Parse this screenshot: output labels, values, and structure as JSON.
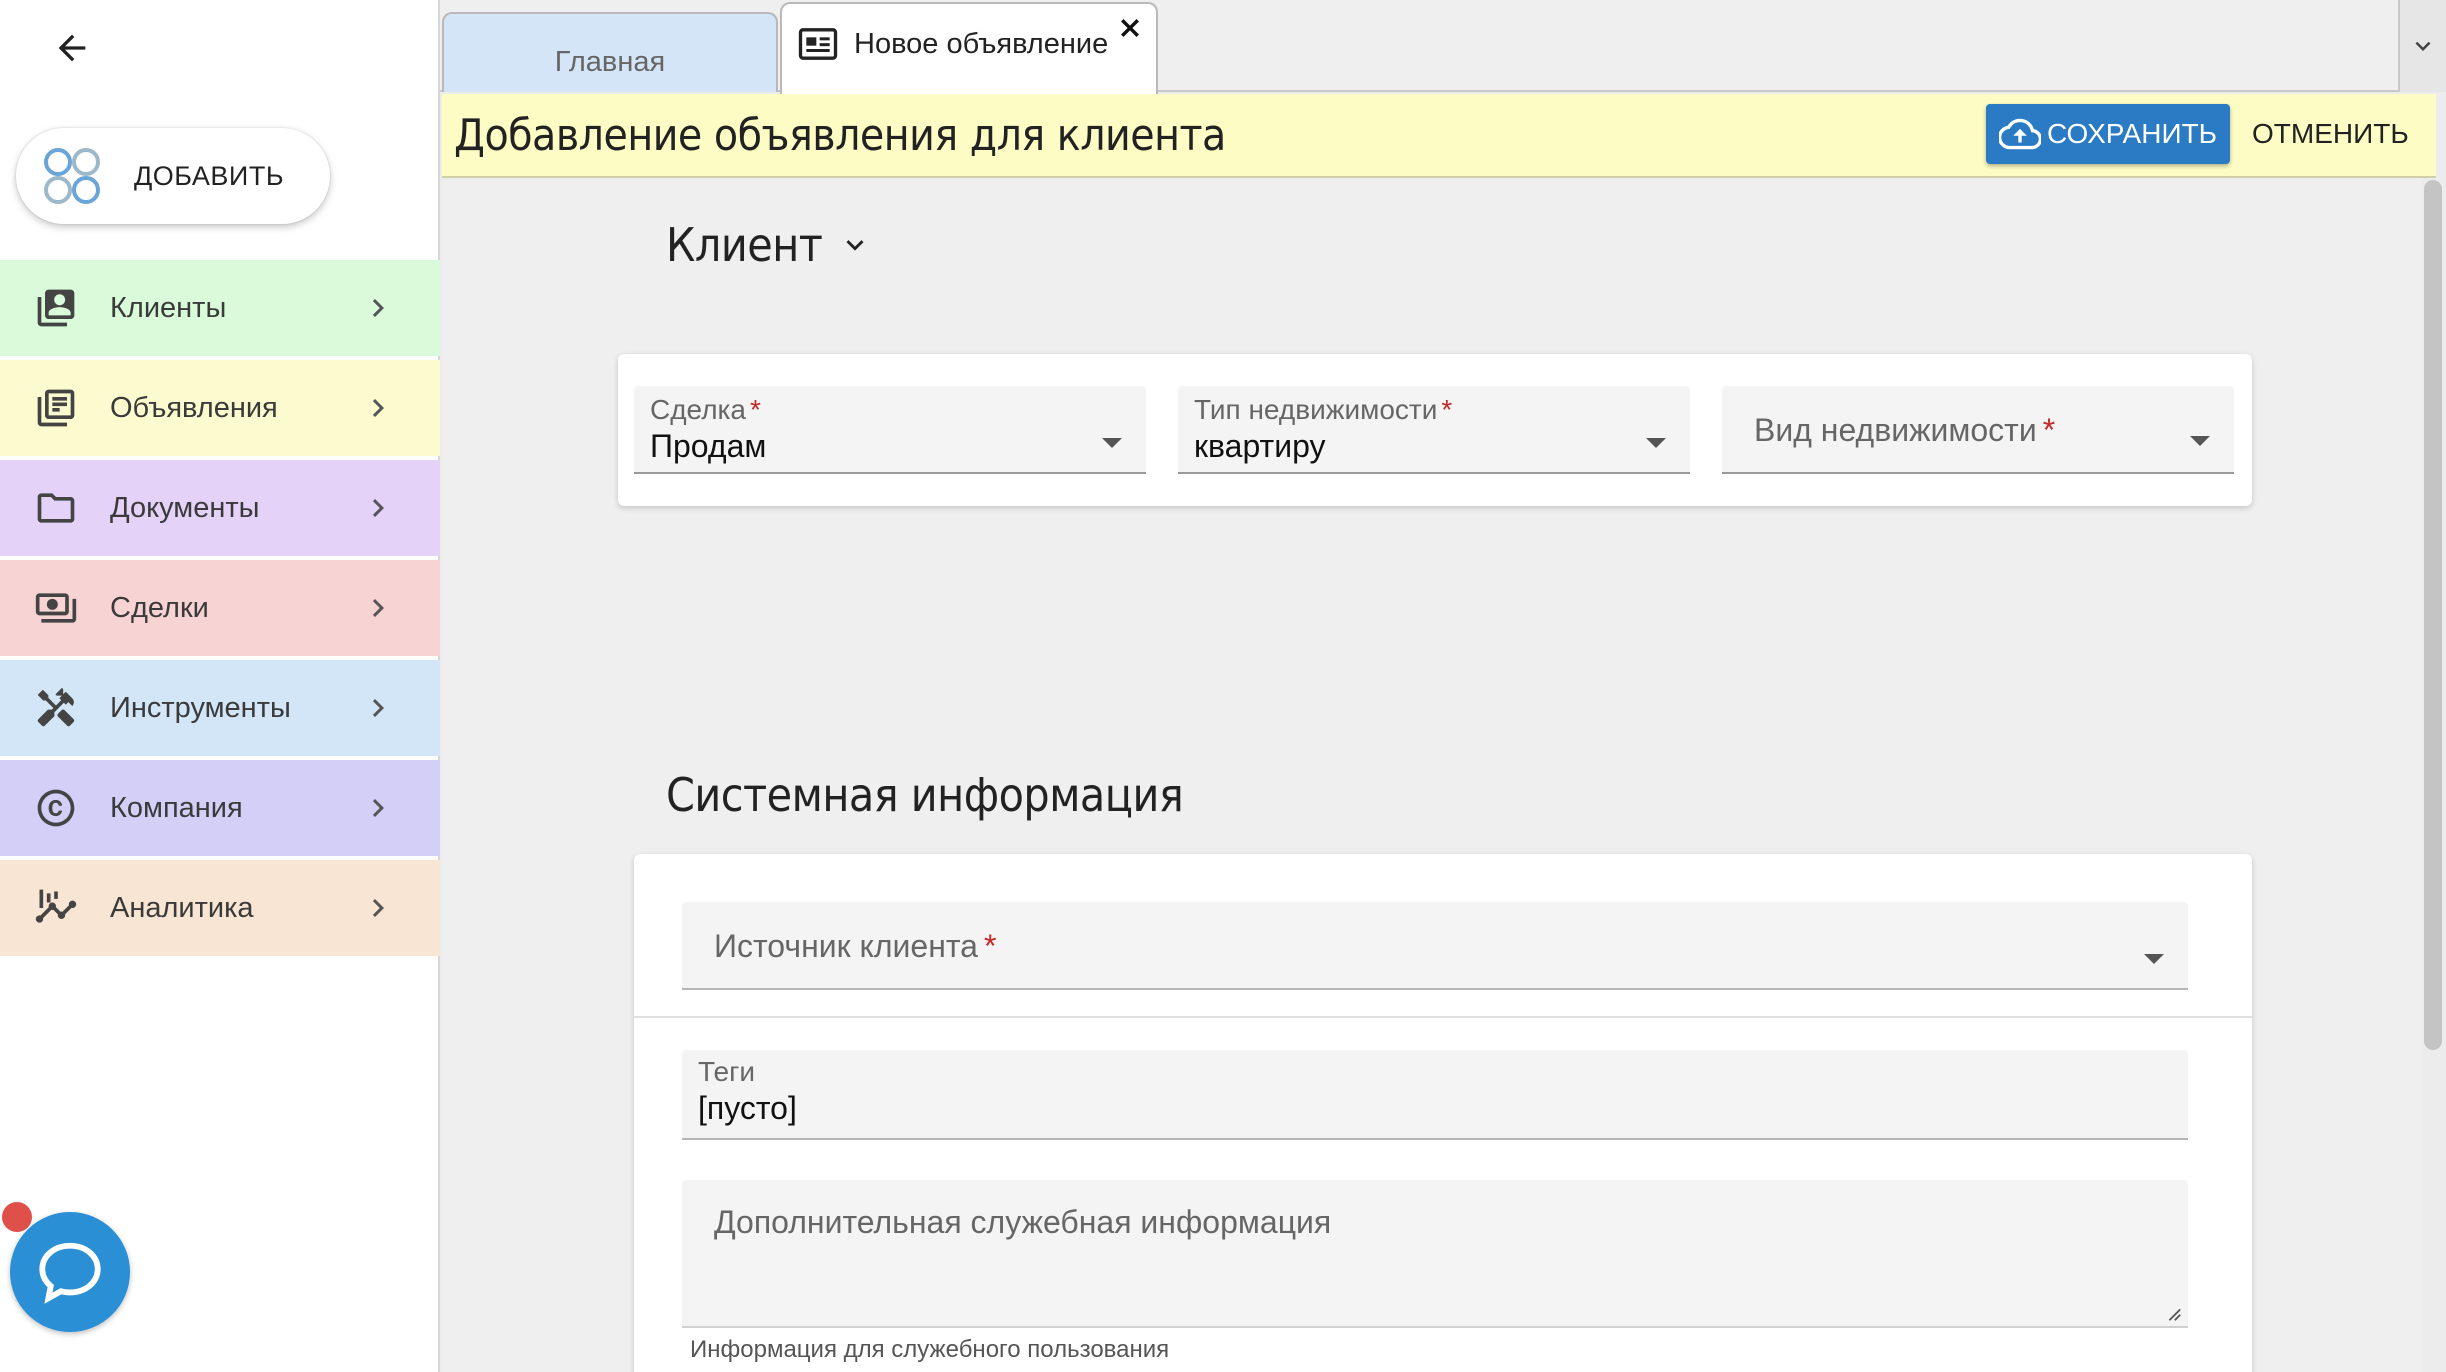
{
  "sidebar": {
    "add_label": "ДОБАВИТЬ",
    "items": [
      {
        "label": "Клиенты",
        "icon": "contacts-icon",
        "bg": "#d9fbd9"
      },
      {
        "label": "Объявления",
        "icon": "listing-icon",
        "bg": "#fbfbcf"
      },
      {
        "label": "Документы",
        "icon": "folder-icon",
        "bg": "#e5d2f8"
      },
      {
        "label": "Сделки",
        "icon": "money-icon",
        "bg": "#f8d3d3"
      },
      {
        "label": "Инструменты",
        "icon": "tools-icon",
        "bg": "#d3e6f8"
      },
      {
        "label": "Компания",
        "icon": "copyright-icon",
        "bg": "#d3cff7"
      },
      {
        "label": "Аналитика",
        "icon": "analytics-icon",
        "bg": "#f8e5d3"
      }
    ]
  },
  "tabs": {
    "home": "Главная",
    "new": "Новое объявление"
  },
  "header": {
    "title": "Добавление объявления для клиента",
    "save_label": "СОХРАНИТЬ",
    "cancel_label": "ОТМЕНИТЬ"
  },
  "client_section": {
    "title": "Клиент"
  },
  "deal": {
    "deal_label": "Сделка",
    "deal_value": "Продам",
    "type_label": "Тип недвижимости",
    "type_value": "квартиру",
    "kind_label": "Вид недвижимости",
    "required_mark": "*"
  },
  "system": {
    "title": "Системная информация",
    "source_label": "Источник клиента",
    "tags_label": "Теги",
    "tags_value": "[пусто]",
    "extra_placeholder": "Дополнительная служебная информация",
    "extra_hint": "Информация для служебного пользования"
  },
  "colors": {
    "accent": "#2a7bc4",
    "header_bg": "#fdfcc4",
    "chat": "#2b8fd6",
    "required": "#c62828"
  }
}
